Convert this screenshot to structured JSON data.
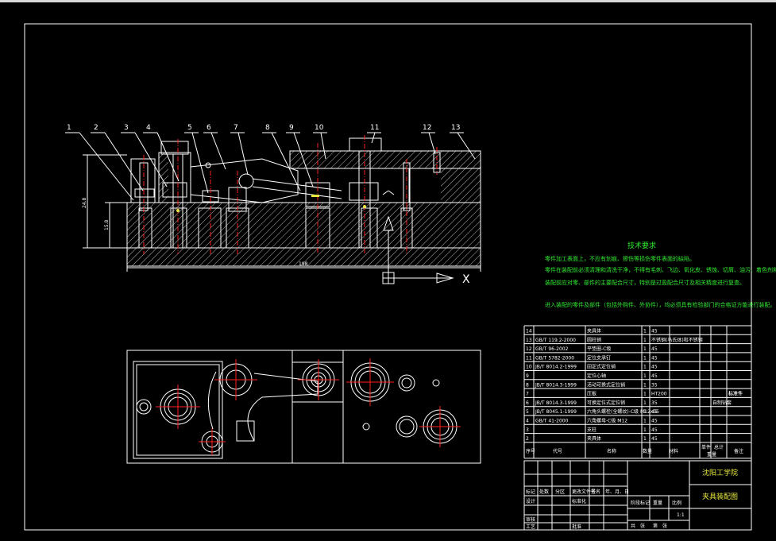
{
  "balloons": [
    "1",
    "2",
    "3",
    "4",
    "5",
    "6",
    "7",
    "8",
    "9",
    "10",
    "11",
    "12",
    "13"
  ],
  "dimensions": {
    "overall_height": "24.8",
    "inner_height": "15.8",
    "overall_length": "198"
  },
  "axis_label": "X",
  "tech_requirements": {
    "title": "技术要求",
    "lines": [
      "零件加工表面上，不应有划痕、擦伤等损伤零件表面的缺陷。",
      "零件在装配前必须清理和清洗干净，不得有毛刺、飞边、氧化皮、锈蚀、切屑、油污、着色剂和灰尘等。",
      "装配前应对零、部件的主要配合尺寸，特别是过盈配合尺寸及相关精度进行复查。",
      "进入装配的零件及部件（包括外购件、外协件），均必须具有检验部门的合格证方能进行装配。"
    ]
  },
  "parts_list": {
    "headers": [
      "序号",
      "代号",
      "名称",
      "数量",
      "材料",
      "单件",
      "总计",
      "备注"
    ],
    "weight_header": "重量",
    "rows": [
      [
        "14",
        "",
        "夹具体",
        "1",
        "45",
        "",
        "",
        ""
      ],
      [
        "13",
        "GB/T 119.2-2000",
        "圆柱销",
        "1",
        "不锈钢(马氏体)和不锈钢",
        "",
        "",
        ""
      ],
      [
        "12",
        "GB/T 96-2002",
        "平垫圈-C级",
        "1",
        "45",
        "",
        "",
        ""
      ],
      [
        "11",
        "GB/T 5782-2000",
        "定位支承钉",
        "1",
        "45",
        "",
        "",
        ""
      ],
      [
        "10",
        "JB/T 8014.2-1999",
        "固定式定位销",
        "1",
        "45",
        "",
        "",
        ""
      ],
      [
        "9",
        "",
        "定位心轴",
        "1",
        "45",
        "",
        "",
        ""
      ],
      [
        "8",
        "JB/T 8014.3-1999",
        "活动可换式定位销",
        "1",
        "35",
        "",
        "",
        ""
      ],
      [
        "7",
        "",
        "压板",
        "1",
        "HT200",
        "",
        "",
        "",
        "标准件"
      ],
      [
        "6",
        "JB/T 8014.3-1999",
        "可换定位式定位销",
        "1",
        "35",
        "",
        "",
        "自制钻套"
      ],
      [
        "5",
        "JB/T 8045.1-1999",
        "六角头螺栓(全螺纹)-C级 M12x35",
        "1",
        "45",
        "",
        "",
        ""
      ],
      [
        "4",
        "GB/T 41-2000",
        "六角螺母-C级 M12",
        "1",
        "45",
        "",
        "",
        ""
      ],
      [
        "3",
        "",
        "支柱",
        "1",
        "45",
        "",
        "",
        ""
      ],
      [
        "2",
        "",
        "夹具体",
        "1",
        "45",
        "",
        "",
        ""
      ]
    ]
  },
  "title_block": {
    "school": "沈阳工学院",
    "drawing_name": "夹具装配图",
    "scale": "1:1",
    "labels": [
      "标记",
      "处数",
      "分区",
      "更改文件号",
      "签名",
      "年、月、日",
      "设计",
      "标准化",
      "阶段标记",
      "重量",
      "比例",
      "审核",
      "工艺",
      "批准",
      "共",
      "张",
      "第",
      "张"
    ]
  }
}
